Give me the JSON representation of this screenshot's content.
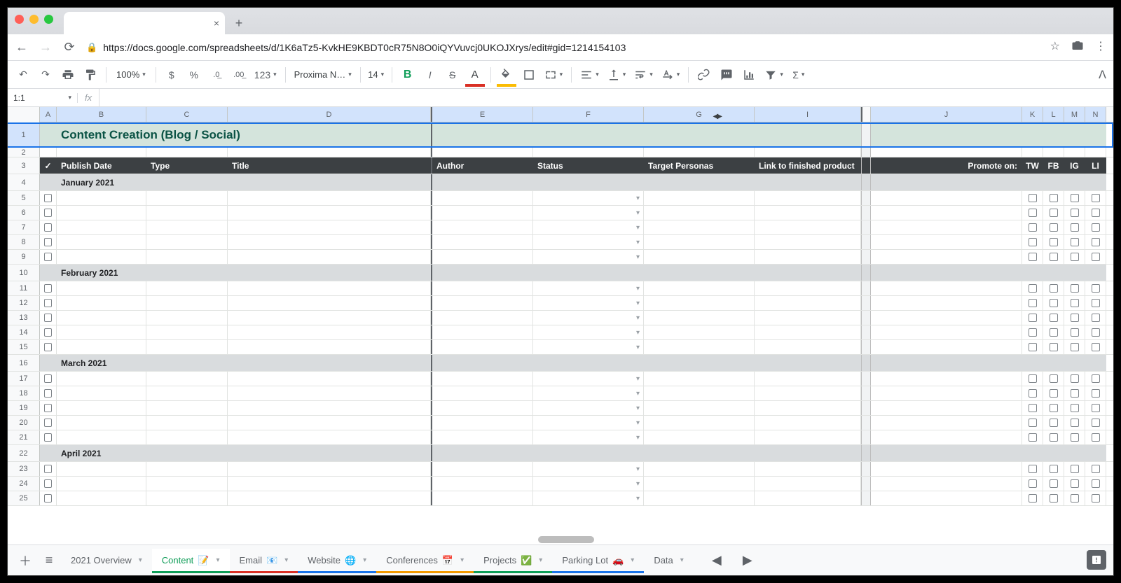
{
  "browser": {
    "url": "https://docs.google.com/spreadsheets/d/1K6aTz5-KvkHE9KBDT0cR75N8O0iQYVuvcj0UKOJXrys/edit#gid=1214154103"
  },
  "toolbar": {
    "zoom": "100%",
    "number_formats": [
      "$",
      "%",
      ".0",
      ".00",
      "123"
    ],
    "font_name": "Proxima N…",
    "font_size": "14"
  },
  "namebox": "1:1",
  "fx_label": "fx",
  "columns": {
    "A": "A",
    "B": "B",
    "C": "C",
    "D": "D",
    "E": "E",
    "F": "F",
    "G": "G",
    "I": "I",
    "J": "J",
    "K": "K",
    "L": "L",
    "M": "M",
    "N": "N"
  },
  "title_row": {
    "text": "Content Creation (Blog / Social)"
  },
  "headers": {
    "check": "✓",
    "publish": "Publish Date",
    "type": "Type",
    "title": "Title",
    "author": "Author",
    "status": "Status",
    "personas": "Target Personas",
    "link": "Link to finished product",
    "promote": "Promote on:",
    "tw": "TW",
    "fb": "FB",
    "ig": "IG",
    "li": "LI"
  },
  "sections": [
    {
      "row": 4,
      "label": "January 2021",
      "items": [
        5,
        6,
        7,
        8,
        9
      ]
    },
    {
      "row": 10,
      "label": "February 2021",
      "items": [
        11,
        12,
        13,
        14,
        15
      ]
    },
    {
      "row": 16,
      "label": "March 2021",
      "items": [
        17,
        18,
        19,
        20,
        21
      ]
    },
    {
      "row": 22,
      "label": "April 2021",
      "items": [
        23,
        24,
        25
      ]
    }
  ],
  "sheets": [
    {
      "name": "2021 Overview",
      "icon": "",
      "color": ""
    },
    {
      "name": "Content",
      "icon": "📝",
      "color": "#0f9d58",
      "active": true
    },
    {
      "name": "Email",
      "icon": "📧",
      "color": "#d93025"
    },
    {
      "name": "Website",
      "icon": "🌐",
      "color": "#1a73e8"
    },
    {
      "name": "Conferences",
      "icon": "📅",
      "color": "#f29900"
    },
    {
      "name": "Projects",
      "icon": "✅",
      "color": "#0f9d58"
    },
    {
      "name": "Parking Lot",
      "icon": "🚗",
      "color": "#1a73e8"
    },
    {
      "name": "Data",
      "icon": "",
      "color": ""
    }
  ]
}
